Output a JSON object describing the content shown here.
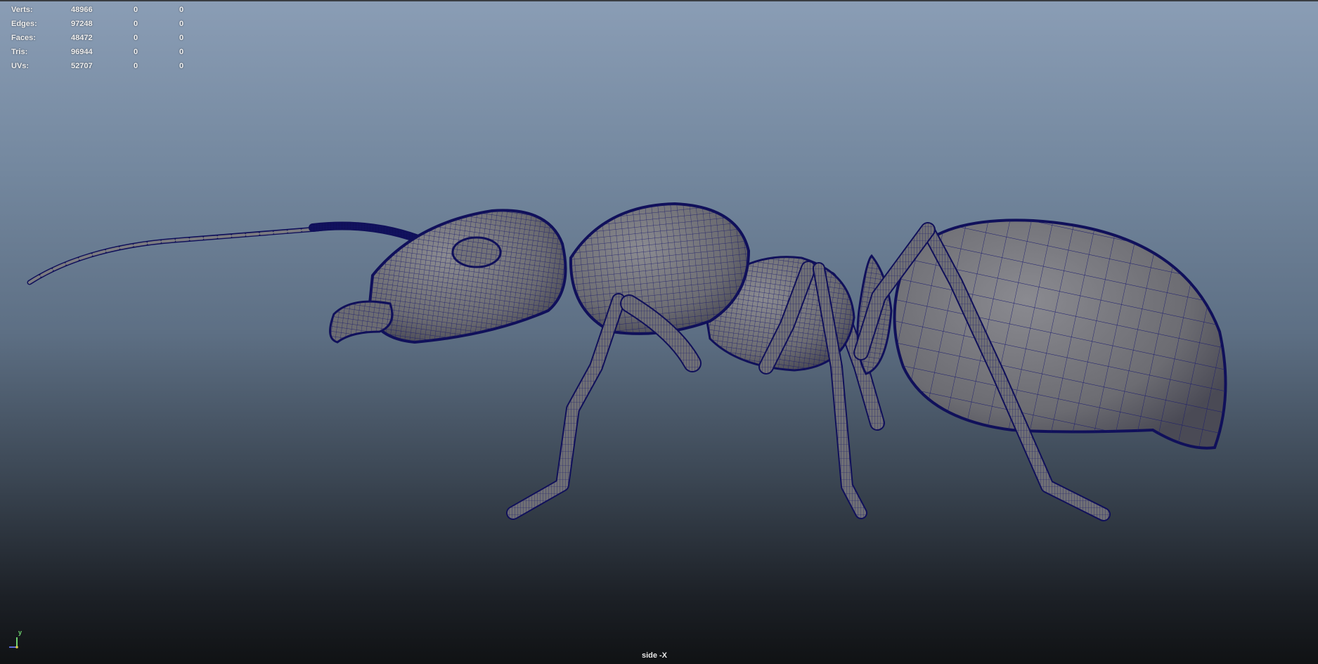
{
  "hud": {
    "rows": [
      {
        "label": "Verts:",
        "value": "48966",
        "selected": "0",
        "uv": "0"
      },
      {
        "label": "Edges:",
        "value": "97248",
        "selected": "0",
        "uv": "0"
      },
      {
        "label": "Faces:",
        "value": "48472",
        "selected": "0",
        "uv": "0"
      },
      {
        "label": "Tris:",
        "value": "96944",
        "selected": "0",
        "uv": "0"
      },
      {
        "label": "UVs:",
        "value": "52707",
        "selected": "0",
        "uv": "0"
      }
    ]
  },
  "viewport": {
    "camera_name": "side -X",
    "model": "ant wireframe mesh",
    "axis_y_label": "y"
  },
  "colors": {
    "wire": "#10105a",
    "shade": "#7b7b80",
    "axis_y": "#6fd26f",
    "axis_z": "#5a6ad8",
    "axis_origin": "#d9c84a"
  }
}
